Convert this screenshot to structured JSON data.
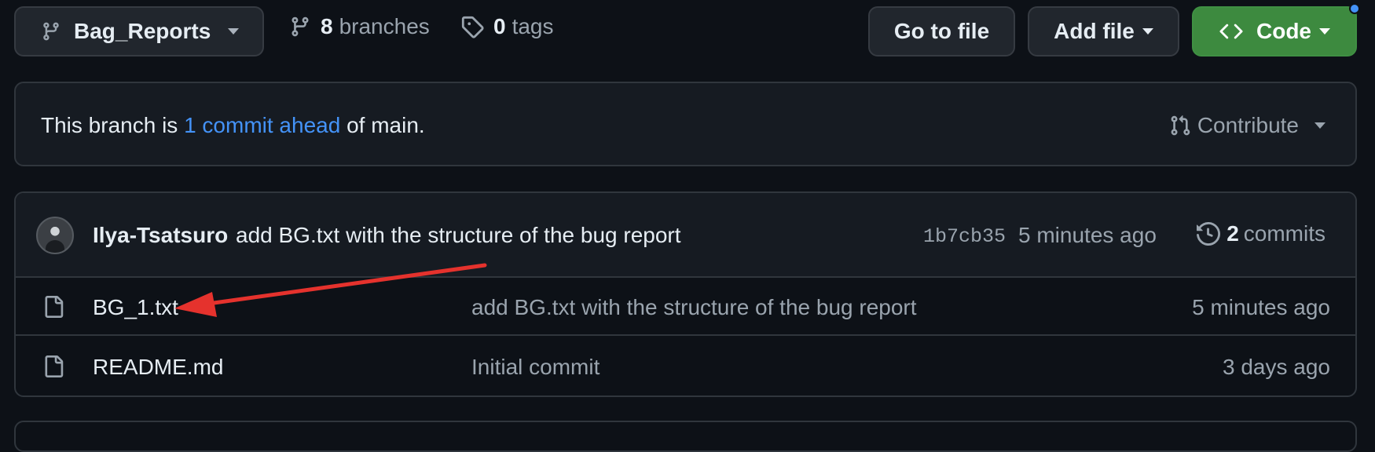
{
  "toolbar": {
    "branch_name": "Bag_Reports",
    "branches_count": "8",
    "branches_label": "branches",
    "tags_count": "0",
    "tags_label": "tags",
    "go_to_file_label": "Go to file",
    "add_file_label": "Add file",
    "code_label": "Code"
  },
  "branch_status": {
    "prefix": "This branch is ",
    "link_text": "1 commit ahead",
    "suffix": " of main.",
    "contribute_label": "Contribute"
  },
  "latest_commit": {
    "author": "Ilya-Tsatsuro",
    "message": "add BG.txt with the structure of the bug report",
    "sha": "1b7cb35",
    "time": "5 minutes ago",
    "commits_count": "2",
    "commits_label": "commits"
  },
  "files": [
    {
      "name": "BG_1.txt",
      "message": "add BG.txt with the structure of the bug report",
      "time": "5 minutes ago"
    },
    {
      "name": "README.md",
      "message": "Initial commit",
      "time": "3 days ago"
    }
  ],
  "icons": {
    "branch": "git-branch-icon",
    "tag": "tag-icon",
    "code": "code-icon",
    "pull_request": "git-pull-request-icon",
    "history": "history-icon",
    "file": "file-icon"
  },
  "colors": {
    "background": "#0d1117",
    "panel": "#161b22",
    "border": "#30363d",
    "link": "#4493f8",
    "primary_button": "#3d8a3f",
    "annotation_arrow": "#e5322d"
  }
}
